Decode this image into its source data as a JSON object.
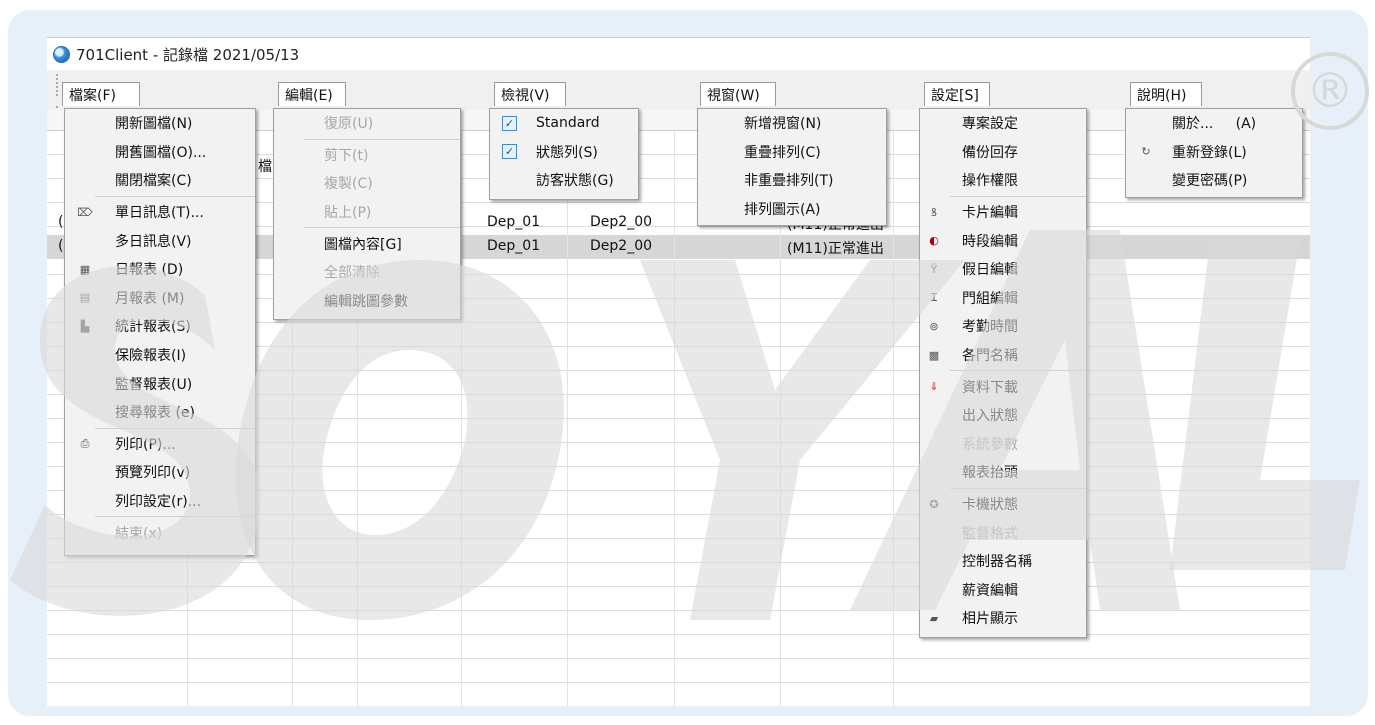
{
  "window": {
    "title": "701Client - 記錄檔 2021/05/13"
  },
  "menubar": {
    "file": "檔案(F)",
    "edit": "編輯(E)",
    "view": "檢視(V)",
    "window": "視窗(W)",
    "settings": "設定[S]",
    "help": "說明(H)"
  },
  "file_menu": [
    {
      "label": "開新圖檔(N)",
      "icon": "",
      "enabled": true
    },
    {
      "label": "開舊圖檔(O)...",
      "icon": "",
      "enabled": true
    },
    {
      "label": "關閉檔案(C)",
      "icon": "",
      "enabled": true
    },
    {
      "label": "單日訊息(T)...",
      "icon": "daily-message-icon",
      "enabled": true
    },
    {
      "label": "多日訊息(V)",
      "icon": "",
      "enabled": true
    },
    {
      "label": "日報表 (D)",
      "icon": "daily-report-icon",
      "enabled": true
    },
    {
      "label": "月報表 (M)",
      "icon": "monthly-report-icon",
      "enabled": true
    },
    {
      "label": "統計報表(S)",
      "icon": "statistics-report-icon",
      "enabled": true
    },
    {
      "label": "保險報表(I)",
      "icon": "",
      "enabled": true
    },
    {
      "label": "監督報表(U)",
      "icon": "",
      "enabled": true
    },
    {
      "label": "搜尋報表 (e)",
      "icon": "",
      "enabled": true
    },
    {
      "label": "列印(P)...",
      "icon": "printer-icon",
      "enabled": true
    },
    {
      "label": "預覽列印(v)",
      "icon": "",
      "enabled": true
    },
    {
      "label": "列印設定(r)...",
      "icon": "",
      "enabled": true
    },
    {
      "label": "結束(x)",
      "icon": "",
      "enabled": false
    }
  ],
  "edit_menu": [
    {
      "label": "復原(U)",
      "enabled": false
    },
    {
      "label": "剪下(t)",
      "enabled": false
    },
    {
      "label": "複製(C)",
      "enabled": false
    },
    {
      "label": "貼上(P)",
      "enabled": false
    },
    {
      "label": "圖檔內容[G]",
      "enabled": true
    },
    {
      "label": "全部清除",
      "enabled": false
    },
    {
      "label": "編輯跳圖參數",
      "enabled": true
    }
  ],
  "view_menu": [
    {
      "label": "Standard",
      "checked": true
    },
    {
      "label": "狀態列(S)",
      "checked": true
    },
    {
      "label": "訪客狀態(G)",
      "checked": false
    }
  ],
  "window_menu": [
    {
      "label": "新增視窗(N)"
    },
    {
      "label": "重疊排列(C)"
    },
    {
      "label": "非重疊排列(T)"
    },
    {
      "label": "排列圖示(A)"
    }
  ],
  "settings_menu": [
    {
      "label": "專案設定",
      "icon": "",
      "enabled": true
    },
    {
      "label": "備份回存",
      "icon": "",
      "enabled": true
    },
    {
      "label": "操作權限",
      "icon": "",
      "enabled": true
    },
    {
      "label": "卡片編輯",
      "icon": "card-edit-icon",
      "enabled": true
    },
    {
      "label": "時段編輯",
      "icon": "time-zone-icon",
      "enabled": true
    },
    {
      "label": "假日編輯",
      "icon": "holiday-icon",
      "enabled": true
    },
    {
      "label": "門組編輯",
      "icon": "door-group-icon",
      "enabled": true
    },
    {
      "label": "考勤時間",
      "icon": "attendance-icon",
      "enabled": true
    },
    {
      "label": "各門名稱",
      "icon": "door-name-icon",
      "enabled": true
    },
    {
      "label": "資料下載",
      "icon": "download-icon",
      "enabled": true
    },
    {
      "label": "出入狀態",
      "icon": "",
      "enabled": true
    },
    {
      "label": "系統參數",
      "icon": "",
      "enabled": false
    },
    {
      "label": "報表抬頭",
      "icon": "",
      "enabled": true
    },
    {
      "label": "卡機狀態",
      "icon": "reader-status-icon",
      "enabled": true
    },
    {
      "label": "監督格式",
      "icon": "",
      "enabled": false
    },
    {
      "label": "控制器名稱",
      "icon": "",
      "enabled": true
    },
    {
      "label": "薪資編輯",
      "icon": "",
      "enabled": true
    },
    {
      "label": "相片顯示",
      "icon": "photo-icon",
      "enabled": true
    }
  ],
  "help_menu": [
    {
      "label": "關於...     (A)",
      "icon": ""
    },
    {
      "label": "重新登錄(L)",
      "icon": "relogin-icon"
    },
    {
      "label": "變更密碼(P)",
      "icon": ""
    }
  ],
  "table": {
    "partial_header": "檔",
    "rows": [
      {
        "dep1": "Dep_01",
        "dep2": "Dep2_00",
        "event": "(M11)正常進出"
      },
      {
        "dep1": "Dep_01",
        "dep2": "Dep2_00",
        "event": "(M11)正常進出"
      }
    ],
    "partial_left": [
      "(",
      "("
    ]
  },
  "watermark": {
    "text": "SOYAL",
    "registered": "®"
  },
  "colors": {
    "frame": "#e7f0f9",
    "selected_row": "#d6d6d6",
    "watermark": "#d8d8d8"
  }
}
